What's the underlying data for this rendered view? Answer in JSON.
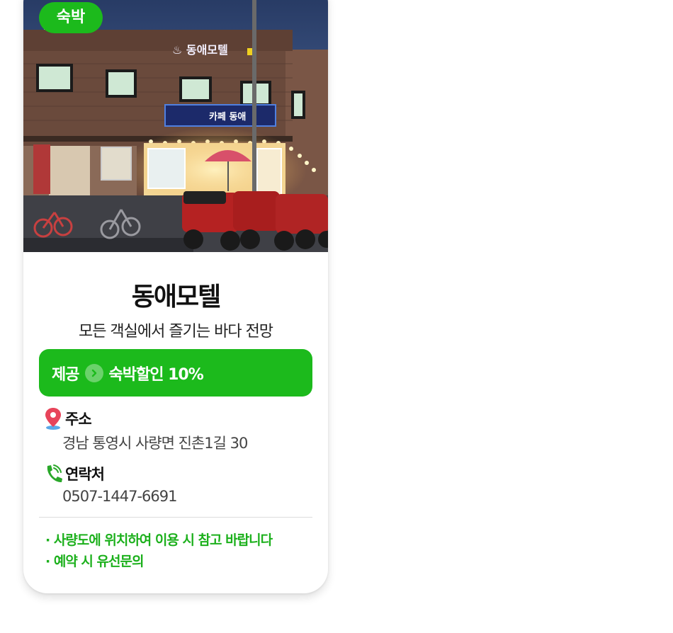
{
  "badge": {
    "label": "숙박"
  },
  "photo": {
    "description_icon": "building-photo",
    "sign_main": "동애모텔",
    "sign_cafe": "카페 동애"
  },
  "lodging": {
    "name": "동애모텔",
    "tagline": "모든 객실에서 즐기는 바다 전망"
  },
  "offer": {
    "label": "제공",
    "text": "숙박할인 10%"
  },
  "address": {
    "label": "주소",
    "value": "경남 통영시 사량면 진촌1길 30"
  },
  "contact": {
    "label": "연락처",
    "value": "0507-1447-6691"
  },
  "notes": [
    "· 사량도에 위치하여 이용 시 참고 바랍니다",
    "· 예약 시 유선문의"
  ],
  "colors": {
    "accent": "#1cba1c",
    "note_text": "#1cb01c",
    "pin": "#e8445a"
  }
}
